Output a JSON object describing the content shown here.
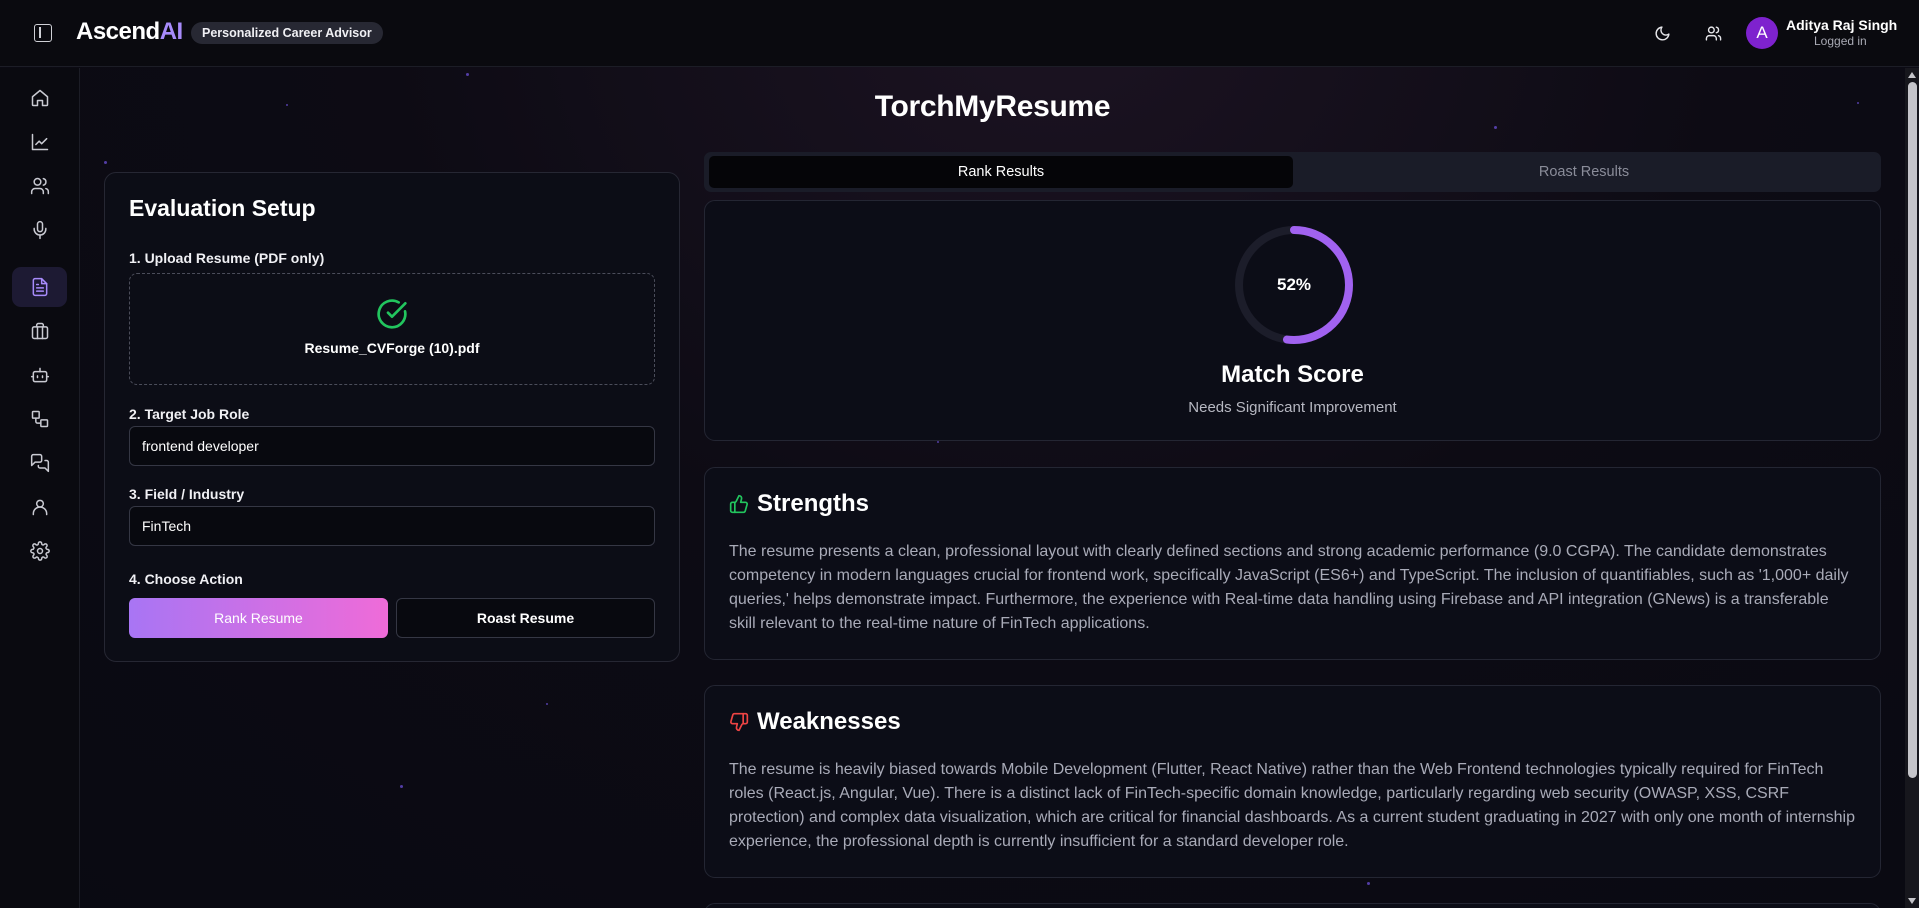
{
  "header": {
    "brand_main": "Ascend",
    "brand_accent": "AI",
    "tagline": "Personalized Career Advisor",
    "user_initial": "A",
    "user_name": "Aditya Raj Singh",
    "user_status": "Logged in"
  },
  "sidebar": {
    "items": [
      {
        "icon": "home-icon"
      },
      {
        "icon": "chart-icon"
      },
      {
        "icon": "users-icon"
      },
      {
        "icon": "microphone-icon"
      },
      {
        "icon": "document-icon",
        "active": true
      },
      {
        "icon": "briefcase-icon"
      },
      {
        "icon": "bot-icon"
      },
      {
        "icon": "flow-icon"
      },
      {
        "icon": "chat-icon"
      },
      {
        "icon": "profile-icon"
      },
      {
        "icon": "settings-icon"
      }
    ]
  },
  "page": {
    "title": "TorchMyResume"
  },
  "setup": {
    "title": "Evaluation Setup",
    "upload_label": "1. Upload Resume (PDF only)",
    "file_name": "Resume_CVForge (10).pdf",
    "role_label": "2. Target Job Role",
    "role_value": "frontend developer",
    "field_label": "3. Field / Industry",
    "field_value": "FinTech",
    "action_label": "4. Choose Action",
    "rank_button": "Rank Resume",
    "roast_button": "Roast Resume"
  },
  "tabs": {
    "rank": "Rank Results",
    "roast": "Roast Results"
  },
  "score": {
    "value": 52,
    "label": "52%",
    "title": "Match Score",
    "subtitle": "Needs Significant Improvement",
    "accent_color": "#a162f0"
  },
  "strengths": {
    "title": "Strengths",
    "body": "The resume presents a clean, professional layout with clearly defined sections and strong academic performance (9.0 CGPA). The candidate demonstrates competency in modern languages crucial for frontend work, specifically JavaScript (ES6+) and TypeScript. The inclusion of quantifiables, such as '1,000+ daily queries,' helps demonstrate impact. Furthermore, the experience with Real-time data handling using Firebase and API integration (GNews) is a transferable skill relevant to the real-time nature of FinTech applications."
  },
  "weaknesses": {
    "title": "Weaknesses",
    "body": "The resume is heavily biased towards Mobile Development (Flutter, React Native) rather than the Web Frontend technologies typically required for FinTech roles (React.js, Angular, Vue). There is a distinct lack of FinTech-specific domain knowledge, particularly regarding web security (OWASP, XSS, CSRF protection) and complex data visualization, which are critical for financial dashboards. As a current student graduating in 2027 with only one month of internship experience, the professional depth is currently insufficient for a standard developer role."
  },
  "colors": {
    "success": "#22c55e",
    "danger": "#ef4444",
    "brand_accent": "#a78bfa"
  }
}
